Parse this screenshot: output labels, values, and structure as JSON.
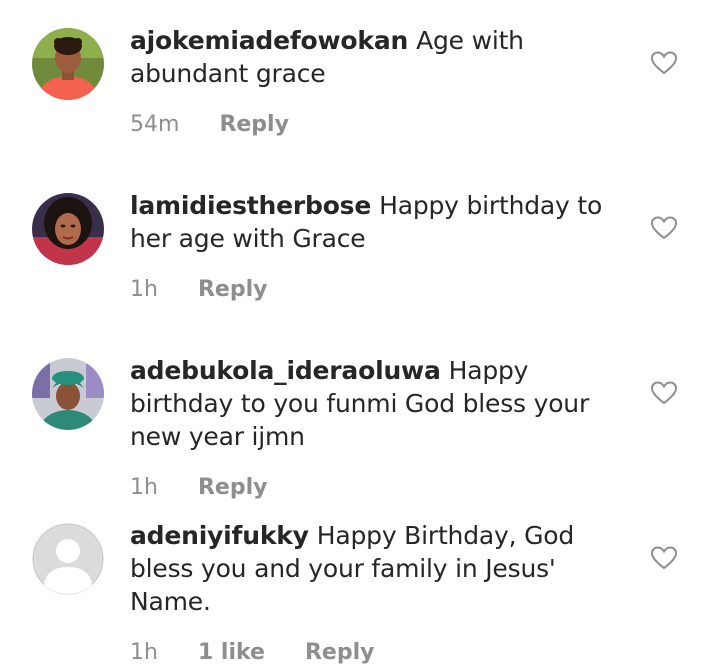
{
  "comments": [
    {
      "username": "ajokemiadefowokan",
      "text": "Age with abundant grace",
      "time": "54m",
      "likes": "",
      "reply_label": "Reply",
      "avatar_icon": "profile-photo"
    },
    {
      "username": "lamidiestherbose",
      "text": "Happy birthday to her age with Grace",
      "time": "1h",
      "likes": "",
      "reply_label": "Reply",
      "avatar_icon": "profile-photo"
    },
    {
      "username": "adebukola_ideraoluwa",
      "text": "Happy birthday to you funmi God bless your new year ijmn",
      "time": "1h",
      "likes": "",
      "reply_label": "Reply",
      "avatar_icon": "profile-photo"
    },
    {
      "username": "adeniyifukky",
      "text": "Happy Birthday, God bless you and your family in Jesus' Name.",
      "time": "1h",
      "likes": "1 like",
      "reply_label": "Reply",
      "avatar_icon": "default-profile-placeholder"
    }
  ],
  "colors": {
    "text": "#262626",
    "muted": "#8e8e8e",
    "heart_outline": "#8e8e8e",
    "placeholder_bg": "#dbdbdb"
  }
}
